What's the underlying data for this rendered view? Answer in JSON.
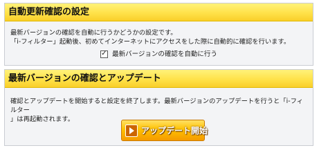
{
  "auto_update_section": {
    "title": "自動更新確認の設定",
    "description_line1": "最新バージョンの確認を自動に行うかどうかの設定です。",
    "description_line2": "「i-フィルター」起動後、初めてインターネットにアクセスをした際に自動的に確認を行います。",
    "checkbox_label": "最新バージョンの確認を自動に行う",
    "checkbox_checked": true
  },
  "update_section": {
    "title": "最新バージョンの確認とアップデート",
    "description_line1": "確認とアップデートを開始すると設定を終了します。最新バージョンのアップデートを行うと「i-フィルター",
    "description_line2": "」は再起動されます。",
    "button_label": "アップデート開始",
    "button_icon": "play-arrow-icon"
  },
  "colors": {
    "header_yellow": "#ffe24a",
    "panel_bg": "#f3f4f6",
    "button_orange": "#ffc200"
  }
}
